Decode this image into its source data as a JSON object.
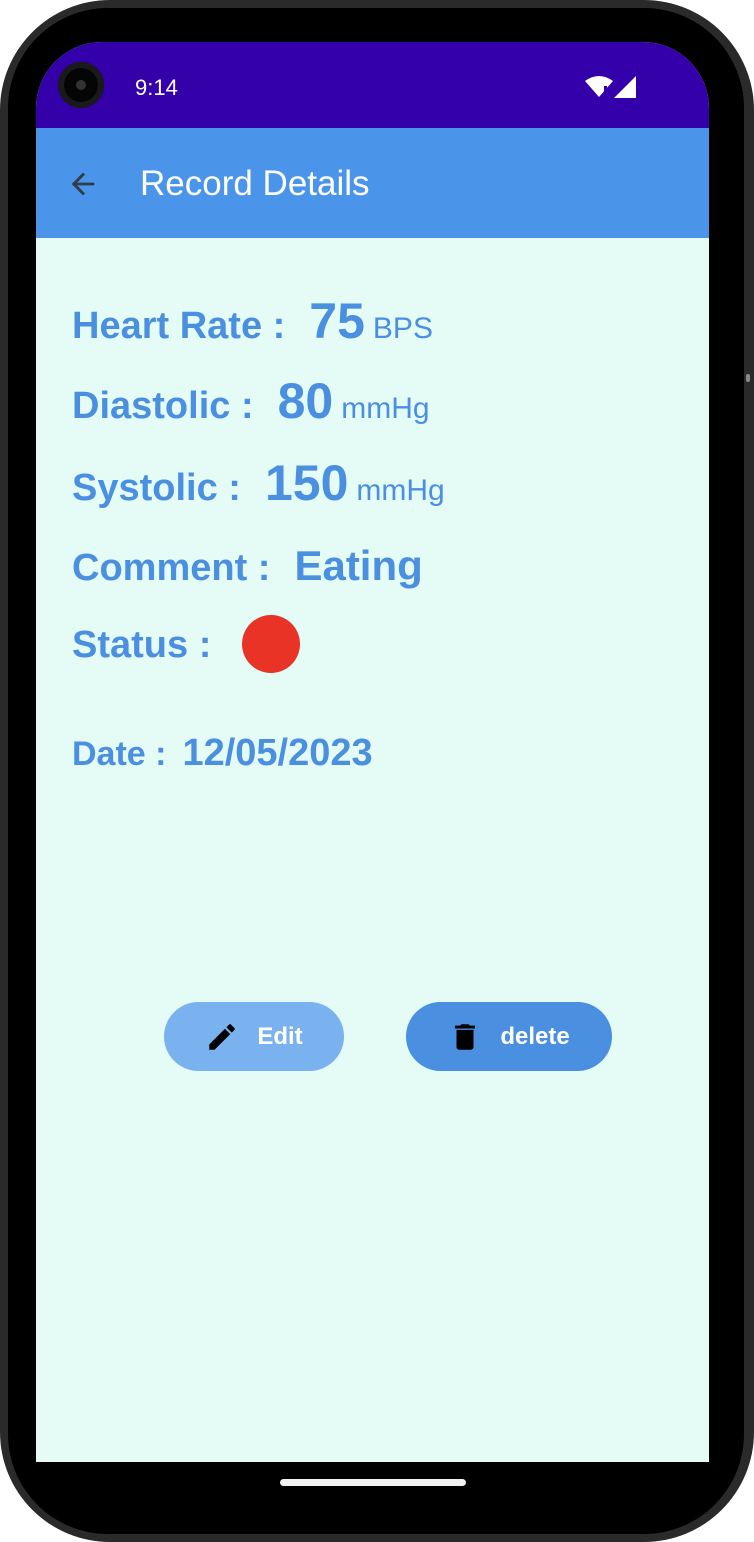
{
  "status_bar": {
    "time": "9:14"
  },
  "app_bar": {
    "title": "Record Details"
  },
  "record": {
    "heart_rate": {
      "label": "Heart Rate :",
      "value": "75",
      "unit": "BPS"
    },
    "diastolic": {
      "label": "Diastolic :",
      "value": "80",
      "unit": "mmHg"
    },
    "systolic": {
      "label": "Systolic :",
      "value": "150",
      "unit": "mmHg"
    },
    "comment": {
      "label": "Comment :",
      "value": "Eating"
    },
    "status": {
      "label": "Status :",
      "color": "#e83326"
    },
    "date": {
      "label": "Date :",
      "value": "12/05/2023"
    }
  },
  "actions": {
    "edit_label": "Edit",
    "delete_label": "delete"
  },
  "colors": {
    "status_bar": "#3300aa",
    "app_bar": "#4a95ea",
    "accent_text": "#4a8fe0",
    "background": "#e4fbf6"
  },
  "icons": {
    "back": "arrow-left-icon",
    "edit": "pencil-icon",
    "delete": "trash-icon",
    "wifi": "wifi-icon",
    "signal": "signal-icon"
  }
}
